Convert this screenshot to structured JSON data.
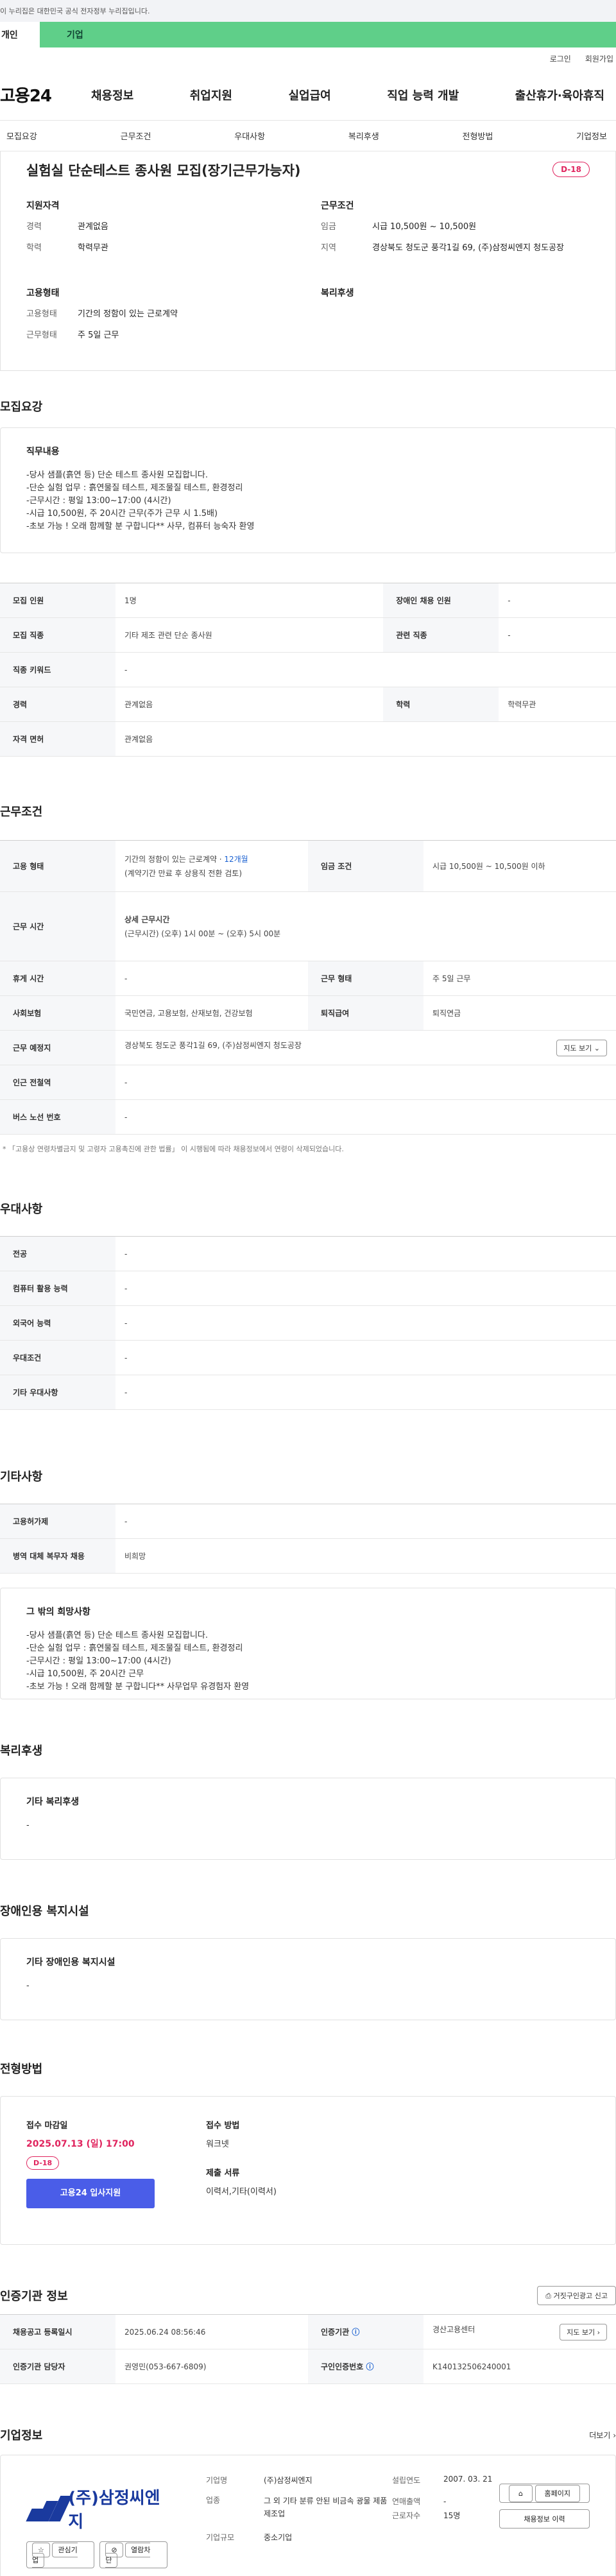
{
  "gov_banner": "이 누리집은 대한민국 공식 전자정부 누리집입니다.",
  "tabs": [
    "개인",
    "기업"
  ],
  "util": [
    "로그인",
    "회원가입"
  ],
  "logo": "고용24",
  "gnb": [
    "채용정보",
    "취업지원",
    "실업급여",
    "직업 능력 개발",
    "출산휴가·육아휴직"
  ],
  "anchors": [
    "모집요강",
    "근무조건",
    "우대사항",
    "복리후생",
    "전형방법",
    "기업정보"
  ],
  "summary": {
    "title": "실험실 단순테스트 종사원 모집(장기근무가능자)",
    "dday": "D-18",
    "left_heading": "지원자격",
    "right_heading": "근무조건",
    "left": [
      {
        "k": "경력",
        "v": "관계없음"
      },
      {
        "k": "학력",
        "v": "학력무관"
      }
    ],
    "right": [
      {
        "k": "임금",
        "v": "시급 10,500원 ~ 10,500원"
      },
      {
        "k": "지역",
        "v": "경상북도 청도군 풍각1길 69, (주)삼정씨엔지 청도공장"
      }
    ],
    "left2_heading": "고용형태",
    "right2_heading": "복리후생",
    "left2": [
      {
        "k": "고용형태",
        "v": "기간의 정함이 있는 근로계약"
      },
      {
        "k": "근무형태",
        "v": "주 5일 근무"
      }
    ]
  },
  "recruit": {
    "heading": "모집요강",
    "duty_title": "직무내용",
    "duty_text": "-당사 샘플(흙연 등) 단순 테스트 종사원 모집합니다.\n-단순 실험 업무 : 흙연물질 테스트, 제조물질 테스트, 환경정리\n-근무시간 : 평일 13:00~17:00 (4시간)\n-시급 10,500원, 주 20시간 근무(주가 근무 시 1.5배)\n-초보 가능 ! 오래 함께할 분 구합니다** 사무, 컴퓨터 능숙자 환영",
    "rows": [
      [
        "모집 인원",
        "1명",
        "장애인 채용 인원",
        "-"
      ],
      [
        "모집 직종",
        "기타 제조 관련 단순 종사원",
        "관련 직종",
        "-"
      ],
      [
        "직종 키워드",
        "-",
        "",
        ""
      ],
      [
        "경력",
        "관계없음",
        "학력",
        "학력무관"
      ],
      [
        "자격 면허",
        "관계없음",
        "",
        ""
      ]
    ]
  },
  "work": {
    "heading": "근무조건",
    "employ_label": "고용 형태",
    "employ_value": "기간의 정함이 있는 근로계약 · ",
    "employ_months": "12개월",
    "employ_sub": "(계약기간 만료 후 상용직 전환 검토)",
    "wage_label": "임금 조건",
    "wage_value": "시급 10,500원 ~ 10,500원 이하",
    "hours_label": "근무 시간",
    "hours_title": "상세 근무시간",
    "hours_value": "(근무시간) (오후) 1시 00분 ~ (오후) 5시 00분",
    "rest_label": "휴게 시간",
    "rest_value": "-",
    "type_label": "근무 형태",
    "type_value": "주 5일 근무",
    "ins_label": "사회보험",
    "ins_value": "국민연금, 고용보험, 산재보험, 건강보험",
    "ret_label": "퇴직급여",
    "ret_value": "퇴직연금",
    "place_label": "근무 예정지",
    "place_value": "경상북도 청도군 풍각1길 69, (주)삼정씨엔지 청도공장",
    "map_btn": "지도 보기",
    "subway_label": "인근 전철역",
    "subway_value": "-",
    "bus_label": "버스 노선 번호",
    "bus_value": "-",
    "note": "* 「고용상 연령차별금지 및 고령자 고용촉진에 관한 법률」 이 시행됨에 따라 채용정보에서 연령이 삭제되었습니다."
  },
  "prefer": {
    "heading": "우대사항",
    "rows": [
      [
        "전공",
        "-"
      ],
      [
        "컴퓨터 활용 능력",
        "-"
      ],
      [
        "외국어 능력",
        "-"
      ],
      [
        "우대조건",
        "-"
      ],
      [
        "기타 우대사항",
        "-"
      ]
    ]
  },
  "etc": {
    "heading": "기타사항",
    "rows": [
      [
        "고용허가제",
        "-"
      ],
      [
        "병역 대체 복무자 채용",
        "비희망"
      ]
    ],
    "wish_title": "그 밖의 희망사항",
    "wish_text": "-당사 샘플(흙연 등) 단순 테스트 종사원 모집합니다.\n-단순 실험 업무 : 흙연물질 테스트, 제조물질 테스트, 환경정리\n-근무시간 : 평일 13:00~17:00 (4시간)\n-시급 10,500원, 주 20시간 근무\n-초보 가능 ! 오래 함께할 분 구합니다** 사무업무 유경험자 환영"
  },
  "welfare": {
    "heading": "복리후생",
    "title": "기타 복리후생",
    "value": "-"
  },
  "disabled": {
    "heading": "장애인용 복지시설",
    "title": "기타 장애인용 복지시설",
    "value": "-"
  },
  "process": {
    "heading": "전형방법",
    "deadline_label": "접수 마감일",
    "deadline": "2025.07.13 (일) 17:00",
    "dday": "D-18",
    "apply_btn": "고용24 입사지원",
    "method_label": "접수 방법",
    "method_value": "워크넷",
    "docs_label": "제출 서류",
    "docs_value": "이력서,기타(이력서)"
  },
  "cert": {
    "heading": "인증기관 정보",
    "report_btn": "거짓구인광고 신고",
    "reg_label": "채용공고 등록일시",
    "reg_value": "2025.06.24 08:56:46",
    "org_label": "인증기관",
    "org_value": "경산고용센터",
    "map_btn": "지도 보기",
    "mgr_label": "인증기관 담당자",
    "mgr_value": "권영민(053-667-6809)",
    "no_label": "구인인증번호",
    "no_value": "K140132506240001"
  },
  "company": {
    "heading": "기업정보",
    "more": "더보기",
    "logo_text": "(주)삼정씨엔지",
    "fav_btn": "관심기업",
    "block_btn": "열람차단",
    "name_label": "기업명",
    "name_value": "(주)삼정씨엔지",
    "founded_label": "설립연도",
    "founded_value": "2007. 03. 21",
    "industry_label": "업종",
    "industry_value": "그 외 기타 분류 안된 비금속 광물 제품 제조업",
    "sales_label": "연매출액",
    "sales_value": "-",
    "emp_label": "근로자수",
    "emp_value": "15명",
    "size_label": "기업규모",
    "size_value": "중소기업",
    "homepage_btn": "홈페이지",
    "history_btn": "채용정보 이력"
  }
}
